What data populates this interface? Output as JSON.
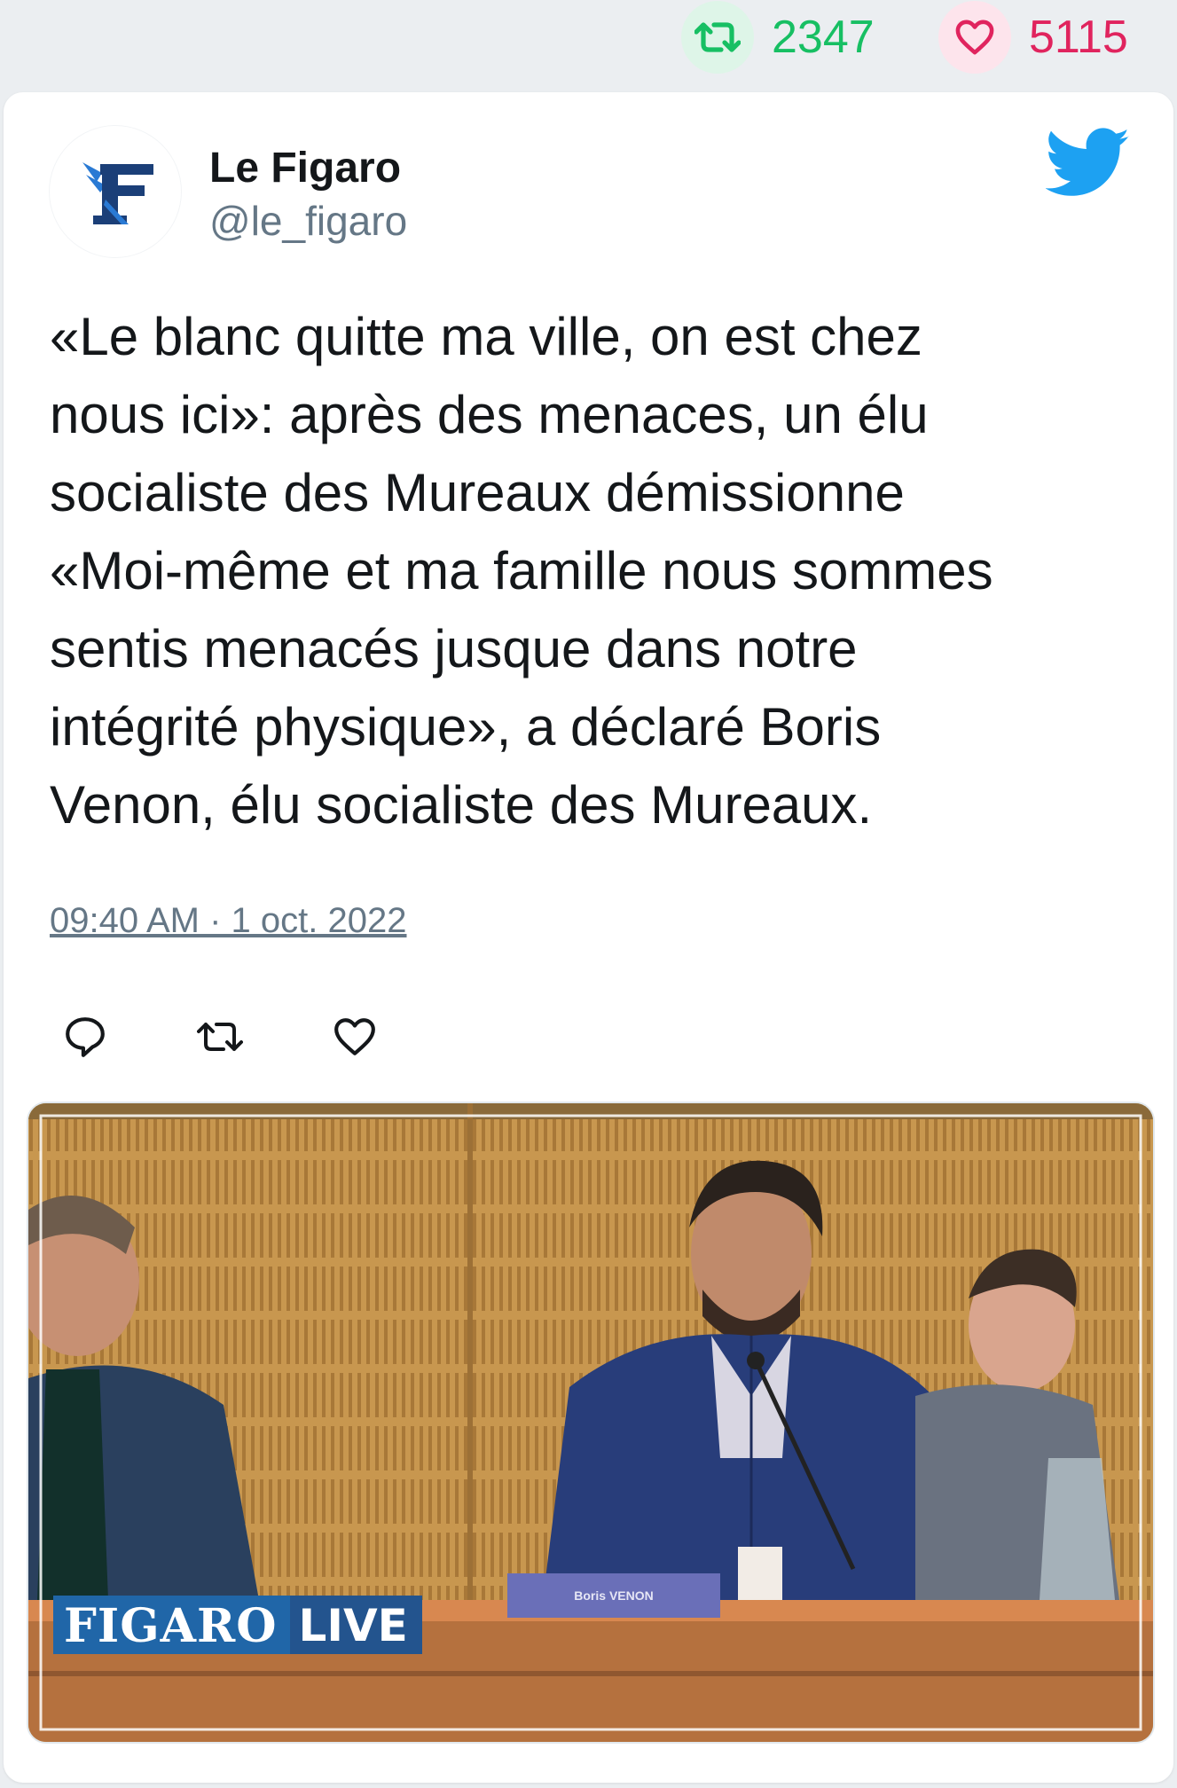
{
  "stats": {
    "retweets": "2347",
    "likes": "5115",
    "retweet_color": "#17bf63",
    "like_color": "#e0245e"
  },
  "tweet": {
    "author_name": "Le Figaro",
    "author_handle": "@le_figaro",
    "avatar_icon": "le-figaro-logo-icon",
    "platform_icon": "twitter-bird-icon",
    "text": "«Le blanc quitte ma ville, on est chez\nnous ici»: après des menaces, un élu\nsocialiste des Mureaux démissionne\n«Moi-même et ma famille nous sommes\nsentis menacés jusque dans notre\nintégrité physique», a déclaré Boris\nVenon, élu socialiste des Mureaux.",
    "timestamp": "09:40 AM · 1 oct. 2022",
    "actions": [
      "reply-icon",
      "retweet-icon",
      "like-icon"
    ]
  },
  "media": {
    "overlay_brand": "FIGARO",
    "overlay_live": "LIVE",
    "nameplate": "Boris VENON"
  }
}
